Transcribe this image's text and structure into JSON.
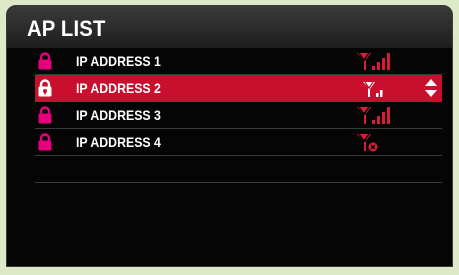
{
  "title": "AP LIST",
  "colors": {
    "accent_red": "#c8102e",
    "lock_pink": "#e6007e",
    "signal_red": "#d81e36"
  },
  "access_points": [
    {
      "label": "IP ADDRESS 1",
      "signal": "full",
      "selected": false
    },
    {
      "label": "IP ADDRESS 2",
      "signal": "weak",
      "selected": true
    },
    {
      "label": "IP ADDRESS 3",
      "signal": "full",
      "selected": false
    },
    {
      "label": "IP ADDRESS 4",
      "signal": "none",
      "selected": false
    }
  ],
  "icons": {
    "lock": "lock-icon",
    "signal": "signal-strength-icon",
    "scroll": "up-down-arrows-icon"
  }
}
